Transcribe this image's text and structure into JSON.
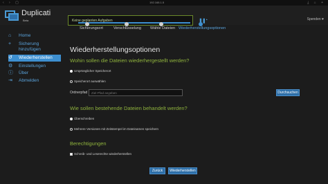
{
  "browser": {
    "nav": "‹ › ▢",
    "url": "192.168.1.5",
    "right_icons": "⤓ ⌂ +"
  },
  "header": {
    "brand": "Duplicati",
    "beta": "Beta",
    "status": "Keine geplanten Aufgaben",
    "donate": "Spenden ♥"
  },
  "sidebar": {
    "items": [
      {
        "label": "Home",
        "icon": "home-icon"
      },
      {
        "label": "Sicherung hinzufügen",
        "icon": "plus-icon"
      },
      {
        "label": "Wiederherstellen",
        "icon": "restore-icon"
      },
      {
        "label": "Einstellungen",
        "icon": "gear-icon"
      },
      {
        "label": "Über",
        "icon": "info-icon"
      },
      {
        "label": "Abmelden",
        "icon": "logout-icon"
      }
    ]
  },
  "steps": [
    "Sicherungsort",
    "Verschlüsselung",
    "Wähle Dateien",
    "Wiederherstellungsoptionen"
  ],
  "main": {
    "title": "Wiederherstellungsoptionen",
    "where_heading": "Wohin sollen die Dateien wiederhergestellt werden?",
    "opt_original": "Ursprünglicher Speicherort",
    "opt_choose": "Speicherort auswählen",
    "folder_label": "Ordnerpfad",
    "folder_placeholder": "Ziel-Pfad angeben",
    "browse": "Durchsuchen",
    "existing_heading": "Wie sollen bestehende Dateien behandelt werden?",
    "opt_overwrite": "Überschreiben",
    "opt_versions": "Mehrere Versionen mit Zeitstempel im Dateinamen speichern",
    "perm_heading": "Berechtigungen",
    "perm_check": "Schreib- und Leserechte wiederherstellen",
    "back": "Zurück",
    "restore": "Wiederherstellen"
  },
  "colors": {
    "accent": "#3d8fd0",
    "heading_green": "#8fb33d",
    "background": "#1c1c1c"
  }
}
